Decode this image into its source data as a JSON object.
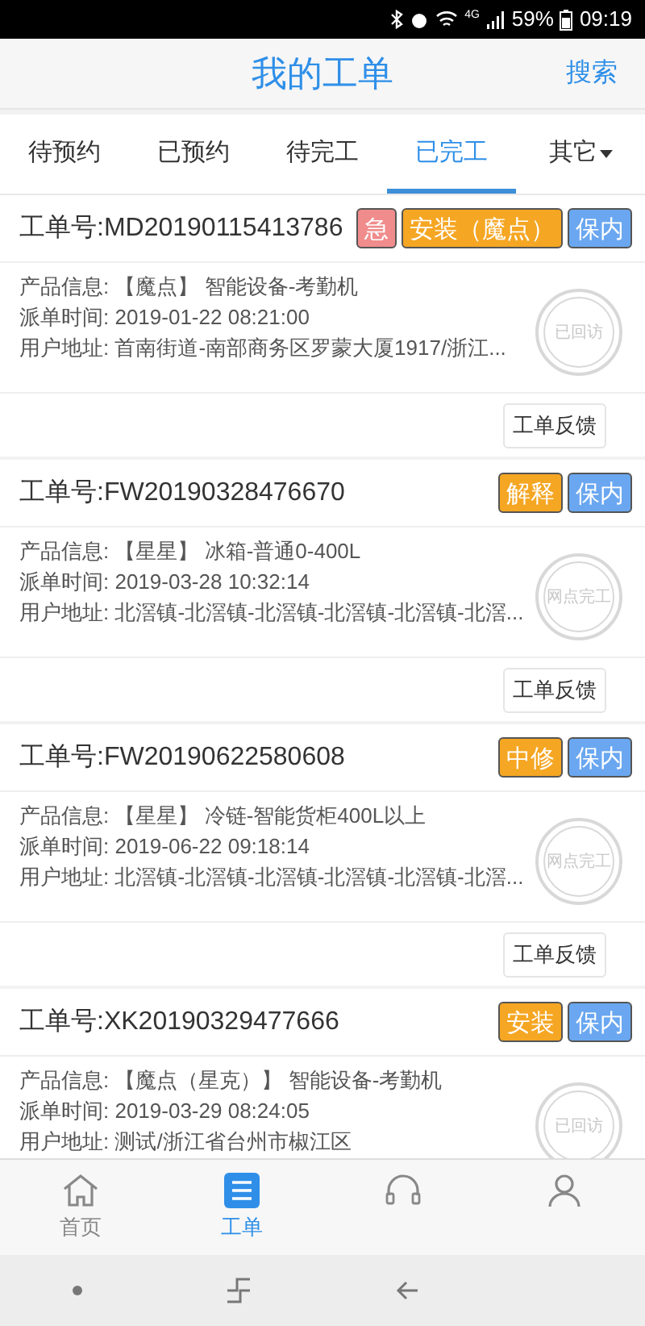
{
  "status_bar": {
    "network": "4G",
    "battery": "59%",
    "time": "09:19"
  },
  "header": {
    "title": "我的工单",
    "action": "搜索"
  },
  "tabs": [
    {
      "label": "待预约",
      "selected": false
    },
    {
      "label": "已预约",
      "selected": false
    },
    {
      "label": "待完工",
      "selected": false
    },
    {
      "label": "已完工",
      "selected": true
    },
    {
      "label": "其它",
      "selected": false,
      "kind": "dropdown"
    }
  ],
  "orders": [
    {
      "number": "工单号:MD20190115413786",
      "tags": [
        {
          "label": "急",
          "color": "#f08c8c"
        },
        {
          "label": "安装（魔点）",
          "color": "#f5a623"
        },
        {
          "label": "保内",
          "color": "#6aa7f0"
        }
      ],
      "product": "产品信息: 【魔点】 智能设备-考勤机",
      "time": "派单时间: 2019-01-22 08:21:00",
      "address": "用户地址: 首南街道-南部商务区罗蒙大厦1917/浙江...",
      "stamp": "已回访",
      "action": "工单反馈"
    },
    {
      "number": "工单号:FW20190328476670",
      "tags": [
        {
          "label": "解释",
          "color": "#f5a623"
        },
        {
          "label": "保内",
          "color": "#6aa7f0"
        }
      ],
      "product": "产品信息: 【星星】 冰箱-普通0-400L",
      "time": "派单时间: 2019-03-28 10:32:14",
      "address": "用户地址: 北滘镇-北滘镇-北滘镇-北滘镇-北滘镇-北滘...",
      "stamp": "网点完工",
      "action": "工单反馈"
    },
    {
      "number": "工单号:FW20190622580608",
      "tags": [
        {
          "label": "中修",
          "color": "#f5a623"
        },
        {
          "label": "保内",
          "color": "#6aa7f0"
        }
      ],
      "product": "产品信息: 【星星】 冷链-智能货柜400L以上",
      "time": "派单时间: 2019-06-22 09:18:14",
      "address": "用户地址: 北滘镇-北滘镇-北滘镇-北滘镇-北滘镇-北滘...",
      "stamp": "网点完工",
      "action": "工单反馈"
    },
    {
      "number": "工单号:XK20190329477666",
      "tags": [
        {
          "label": "安装",
          "color": "#f5a623"
        },
        {
          "label": "保内",
          "color": "#6aa7f0"
        }
      ],
      "product": "产品信息: 【魔点（星克）】 智能设备-考勤机",
      "time": "派单时间: 2019-03-29 08:24:05",
      "address": "用户地址: 测试/浙江省台州市椒江区",
      "stamp": "已回访"
    }
  ],
  "bottom_nav": [
    {
      "label": "首页",
      "kind": "home",
      "selected": false
    },
    {
      "label": "工单",
      "kind": "list",
      "selected": true
    },
    {
      "kind": "headset",
      "selected": false
    },
    {
      "kind": "person",
      "selected": false
    }
  ]
}
